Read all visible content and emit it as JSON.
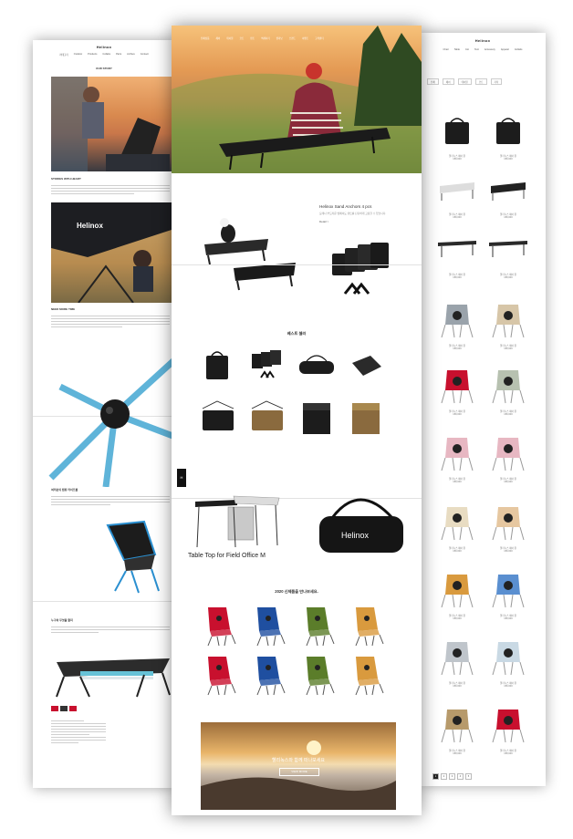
{
  "left_page": {
    "logo": "Helinox",
    "nav": [
      "카테고리",
      "Outdoor",
      "Products",
      "Collabs",
      "Parts",
      "Archive",
      "Contact"
    ],
    "section_title": "OUR STORY",
    "subheads": [
      "STORIES WITH HEART",
      "NEED MORE TIME",
      "여러분의 캠핑 라이프를",
      "누구와 무엇을 할지"
    ],
    "footer_brand": "Helinox"
  },
  "center_page": {
    "top_nav": [
      "전체상품",
      "체어",
      "테이블",
      "코트",
      "텐트",
      "액세서리",
      "콜라보",
      "브랜드",
      "이벤트",
      "고객센터"
    ],
    "promo_title": "Helinox Sand Anchors 4 pcs",
    "promo_desc": "모래나 부드러운 땅에서도 텐트를 단단하게 고정할 수 있습니다.",
    "promo_link": "Detail >",
    "best_title": "베스트 셀러",
    "feature_caption": "Table Top for Field Office M",
    "new_title": "2020 신제품을 만나보세요.",
    "banner_text": "헬리녹스와 함께 떠나보세요",
    "banner_button": "VIEW MORE",
    "side_badge": "H"
  },
  "right_page": {
    "logo": "Helinox",
    "nav": [
      "Chair",
      "Table",
      "Cot",
      "Tent",
      "Accessory",
      "Apparel",
      "Collabs"
    ],
    "filters": [
      "전체",
      "체어",
      "테이블",
      "코트",
      "기타"
    ],
    "product_label": "헬리녹스 체어 원",
    "price": "159,000",
    "pagination": [
      "1",
      "2",
      "3",
      "4",
      "5"
    ]
  },
  "colors": {
    "accent_red": "#c8102e",
    "chair_blue": "#1f4fa0",
    "chair_green": "#5b7d2a",
    "chair_orange": "#d99a3e",
    "chair_pink": "#e7b7c2"
  }
}
